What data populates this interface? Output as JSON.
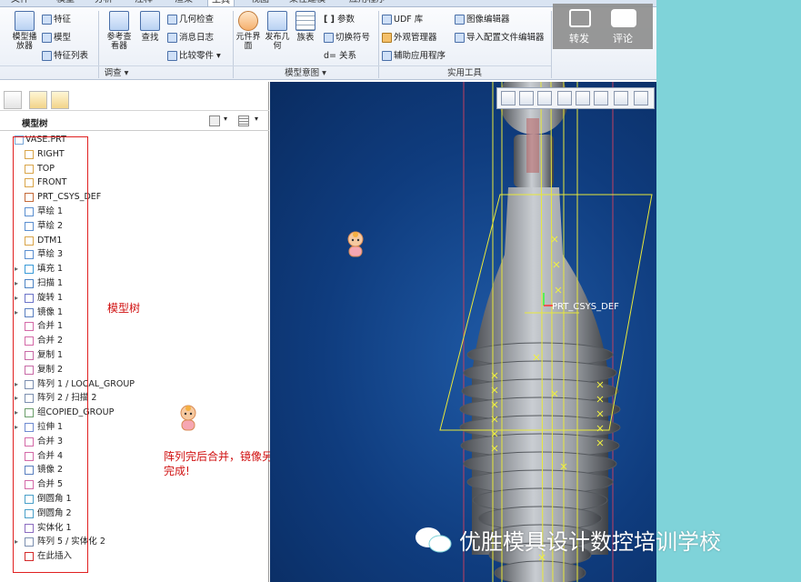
{
  "tabs": [
    "文件",
    "模型",
    "分析",
    "注释",
    "渲染",
    "工具",
    "视图",
    "柔性建模",
    "应用程序"
  ],
  "active_tab": "工具",
  "ribbon": {
    "model_player": "模型播放器",
    "feature": "特征",
    "model": "模型",
    "feature_list": "特征列表",
    "ref_viewer": "参考查看器",
    "find": "查找",
    "geo_check": "几何检查",
    "msg_log": "消息日志",
    "compare_parts": "比较零件",
    "investigate": "调查",
    "component_interface": "元件界面",
    "publish_geometry": "发布几何",
    "family_table": "族表",
    "params": "参数",
    "switch_symbols": "切换符号",
    "relations": "关系",
    "model_intent": "模型意图",
    "udf_lib": "UDF 库",
    "appearance_mgr": "外观管理器",
    "aux_apps": "辅助应用程序",
    "image_editor": "图像编辑器",
    "import_config_editor": "导入配置文件编辑器",
    "utilities": "实用工具"
  },
  "share": {
    "forward": "转发",
    "comment": "评论"
  },
  "tree": {
    "header": "模型树",
    "items": [
      {
        "label": "VASE.PRT",
        "icon": "part-icon",
        "expand": false
      },
      {
        "label": "RIGHT",
        "icon": "datum-plane-icon",
        "expand": false
      },
      {
        "label": "TOP",
        "icon": "datum-plane-icon",
        "expand": false
      },
      {
        "label": "FRONT",
        "icon": "datum-plane-icon",
        "expand": false
      },
      {
        "label": "PRT_CSYS_DEF",
        "icon": "csys-icon",
        "expand": false
      },
      {
        "label": "草绘 1",
        "icon": "sketch-icon",
        "expand": false
      },
      {
        "label": "草绘 2",
        "icon": "sketch-icon",
        "expand": false
      },
      {
        "label": "DTM1",
        "icon": "datum-plane-icon",
        "expand": false
      },
      {
        "label": "草绘 3",
        "icon": "sketch-icon",
        "expand": false
      },
      {
        "label": "填充 1",
        "icon": "fill-icon",
        "expand": true
      },
      {
        "label": "扫描 1",
        "icon": "sweep-icon",
        "expand": true
      },
      {
        "label": "旋转 1",
        "icon": "revolve-icon",
        "expand": true
      },
      {
        "label": "镜像 1",
        "icon": "mirror-icon",
        "expand": true
      },
      {
        "label": "合并 1",
        "icon": "merge-icon",
        "expand": false
      },
      {
        "label": "合并 2",
        "icon": "merge-icon",
        "expand": false
      },
      {
        "label": "复制 1",
        "icon": "copy-icon",
        "expand": false
      },
      {
        "label": "复制 2",
        "icon": "copy-icon",
        "expand": false
      },
      {
        "label": "阵列 1 / LOCAL_GROUP",
        "icon": "pattern-icon",
        "expand": true
      },
      {
        "label": "阵列 2 / 扫描 2",
        "icon": "pattern-icon",
        "expand": true
      },
      {
        "label": "组COPIED_GROUP",
        "icon": "group-icon",
        "expand": true
      },
      {
        "label": "拉伸 1",
        "icon": "extrude-icon",
        "expand": true
      },
      {
        "label": "合并 3",
        "icon": "merge-icon",
        "expand": false
      },
      {
        "label": "合并 4",
        "icon": "merge-icon",
        "expand": false
      },
      {
        "label": "镜像 2",
        "icon": "mirror-icon",
        "expand": false
      },
      {
        "label": "合并 5",
        "icon": "merge-icon",
        "expand": false
      },
      {
        "label": "倒圆角 1",
        "icon": "round-icon",
        "expand": false
      },
      {
        "label": "倒圆角 2",
        "icon": "round-icon",
        "expand": false
      },
      {
        "label": "实体化 1",
        "icon": "solidify-icon",
        "expand": false
      },
      {
        "label": "阵列 5 / 实体化 2",
        "icon": "pattern-icon",
        "expand": true
      },
      {
        "label": "在此插入",
        "icon": "insert-here-icon",
        "expand": false
      }
    ]
  },
  "annotations": {
    "tree_label": "模型树",
    "note_line1": "阵列完后合并，镜像另一半，再实体化",
    "note_line2": "完成!"
  },
  "viewport": {
    "csys_label": "PRT_CSYS_DEF"
  },
  "watermark": "优胜模具设计数控培训学校"
}
